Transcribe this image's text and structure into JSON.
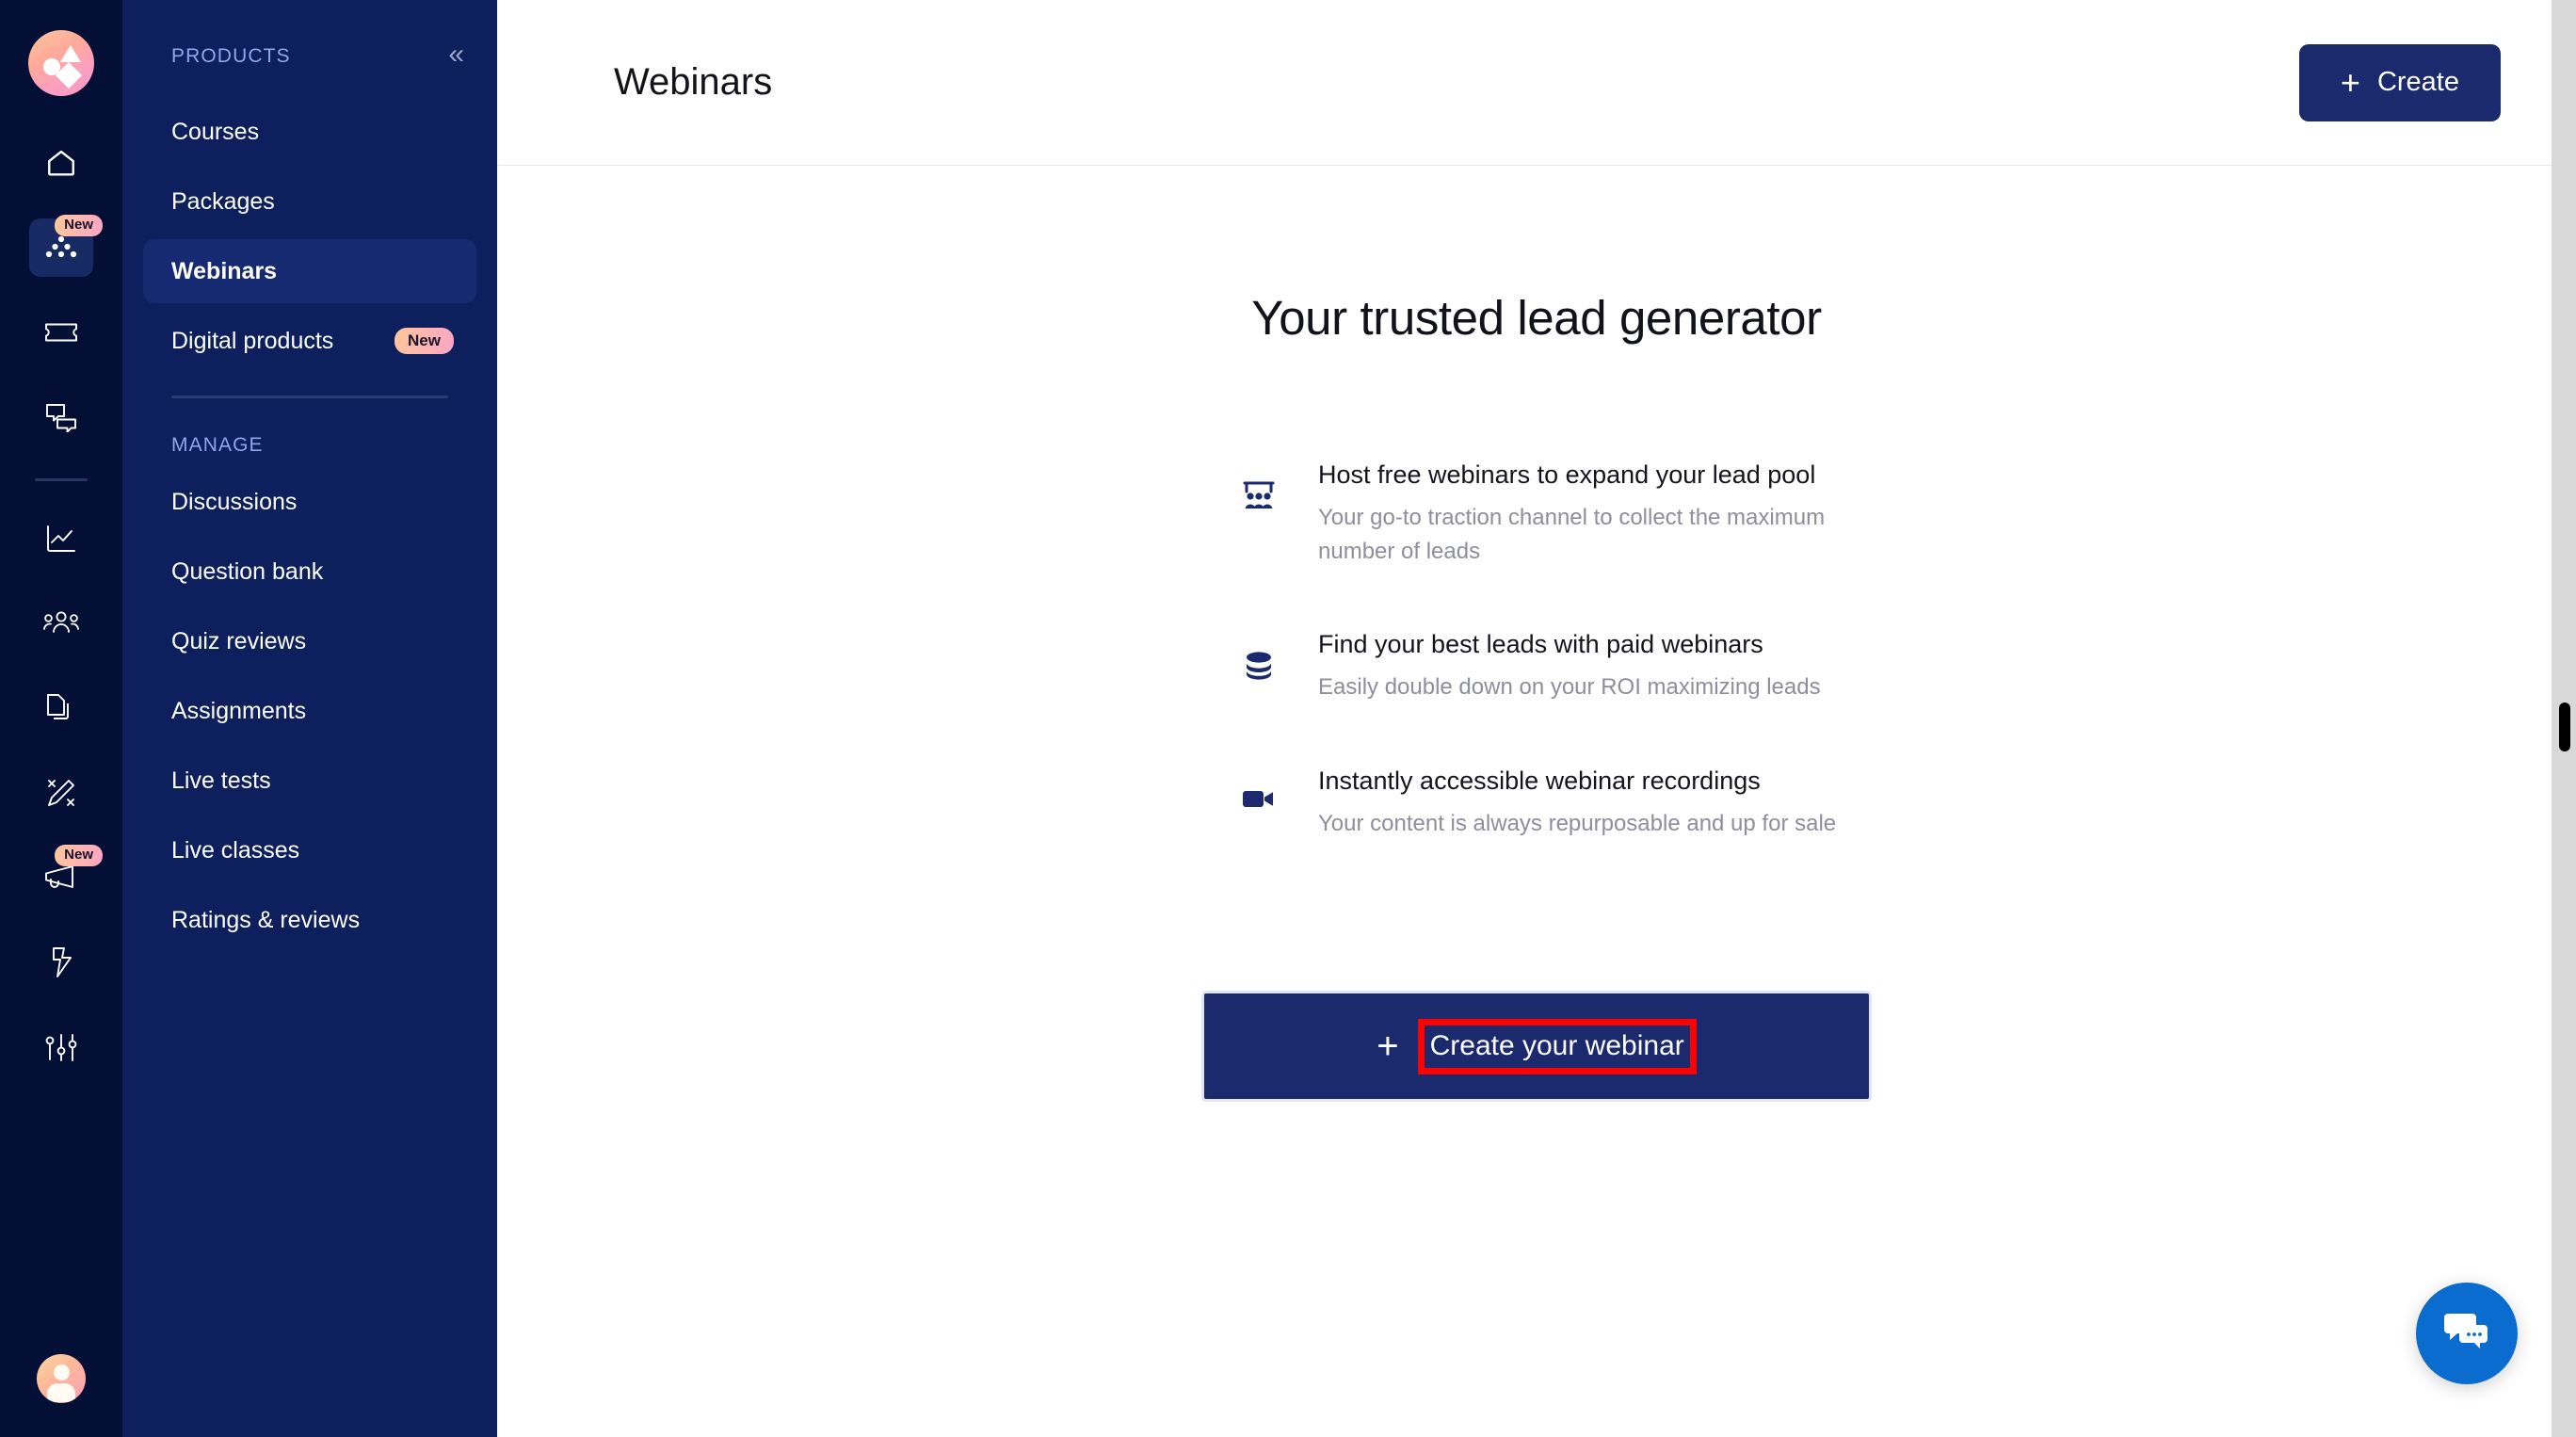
{
  "rail": {
    "logo_name": "shaw-academy-logo",
    "items": [
      {
        "icon": "home-icon",
        "name": "rail-item-home",
        "active": false,
        "badge": ""
      },
      {
        "icon": "products-icon",
        "name": "rail-item-products",
        "active": true,
        "badge": "New"
      },
      {
        "icon": "ticket-icon",
        "name": "rail-item-coupons",
        "active": false,
        "badge": ""
      },
      {
        "icon": "chat-icon",
        "name": "rail-item-messages",
        "active": false,
        "badge": ""
      },
      {
        "icon": "analytics-icon",
        "name": "rail-item-analytics",
        "active": false,
        "badge": ""
      },
      {
        "icon": "people-icon",
        "name": "rail-item-learners",
        "active": false,
        "badge": ""
      },
      {
        "icon": "pages-icon",
        "name": "rail-item-pages",
        "active": false,
        "badge": ""
      },
      {
        "icon": "design-icon",
        "name": "rail-item-design",
        "active": false,
        "badge": ""
      },
      {
        "icon": "megaphone-icon",
        "name": "rail-item-marketing",
        "active": false,
        "badge": "New"
      },
      {
        "icon": "bolt-icon",
        "name": "rail-item-automation",
        "active": false,
        "badge": ""
      },
      {
        "icon": "sliders-icon",
        "name": "rail-item-settings",
        "active": false,
        "badge": ""
      }
    ],
    "avatar_name": "user-avatar"
  },
  "sidebar": {
    "products_label": "PRODUCTS",
    "collapse_icon": "«",
    "products_items": [
      {
        "label": "Courses",
        "active": false,
        "badge": ""
      },
      {
        "label": "Packages",
        "active": false,
        "badge": ""
      },
      {
        "label": "Webinars",
        "active": true,
        "badge": ""
      },
      {
        "label": "Digital products",
        "active": false,
        "badge": "New"
      }
    ],
    "manage_label": "MANAGE",
    "manage_items": [
      {
        "label": "Discussions",
        "active": false,
        "badge": ""
      },
      {
        "label": "Question bank",
        "active": false,
        "badge": ""
      },
      {
        "label": "Quiz reviews",
        "active": false,
        "badge": ""
      },
      {
        "label": "Assignments",
        "active": false,
        "badge": ""
      },
      {
        "label": "Live tests",
        "active": false,
        "badge": ""
      },
      {
        "label": "Live classes",
        "active": false,
        "badge": ""
      },
      {
        "label": "Ratings & reviews",
        "active": false,
        "badge": ""
      }
    ]
  },
  "header": {
    "title": "Webinars",
    "create_label": "Create",
    "create_plus": "+"
  },
  "main": {
    "hero_title": "Your trusted lead generator",
    "features": [
      {
        "icon": "presentation-audience-icon",
        "title": "Host free webinars to expand your lead pool",
        "desc": "Your go-to traction channel to collect the maximum number of leads"
      },
      {
        "icon": "coins-stack-icon",
        "title": "Find your best leads with paid webinars",
        "desc": "Easily double down on your ROI maximizing leads"
      },
      {
        "icon": "video-camera-icon",
        "title": "Instantly accessible webinar recordings",
        "desc": "Your content is always repurposable and up for sale"
      }
    ],
    "cta_plus": "+",
    "cta_label": "Create your webinar"
  },
  "chat": {
    "icon": "chat-bubbles-icon"
  },
  "colors": {
    "rail_bg": "#040f35",
    "sidebar_bg": "#0d1f5c",
    "sidebar_active": "#162a71",
    "accent_navy": "#1a2a6c",
    "badge_gradient_start": "#ffc79b",
    "badge_gradient_end": "#fca5c4",
    "section_label": "#93a4e8",
    "muted_text": "#8e8e9c",
    "highlight_red": "#ff0000",
    "chat_blue": "#0b6ccf"
  }
}
